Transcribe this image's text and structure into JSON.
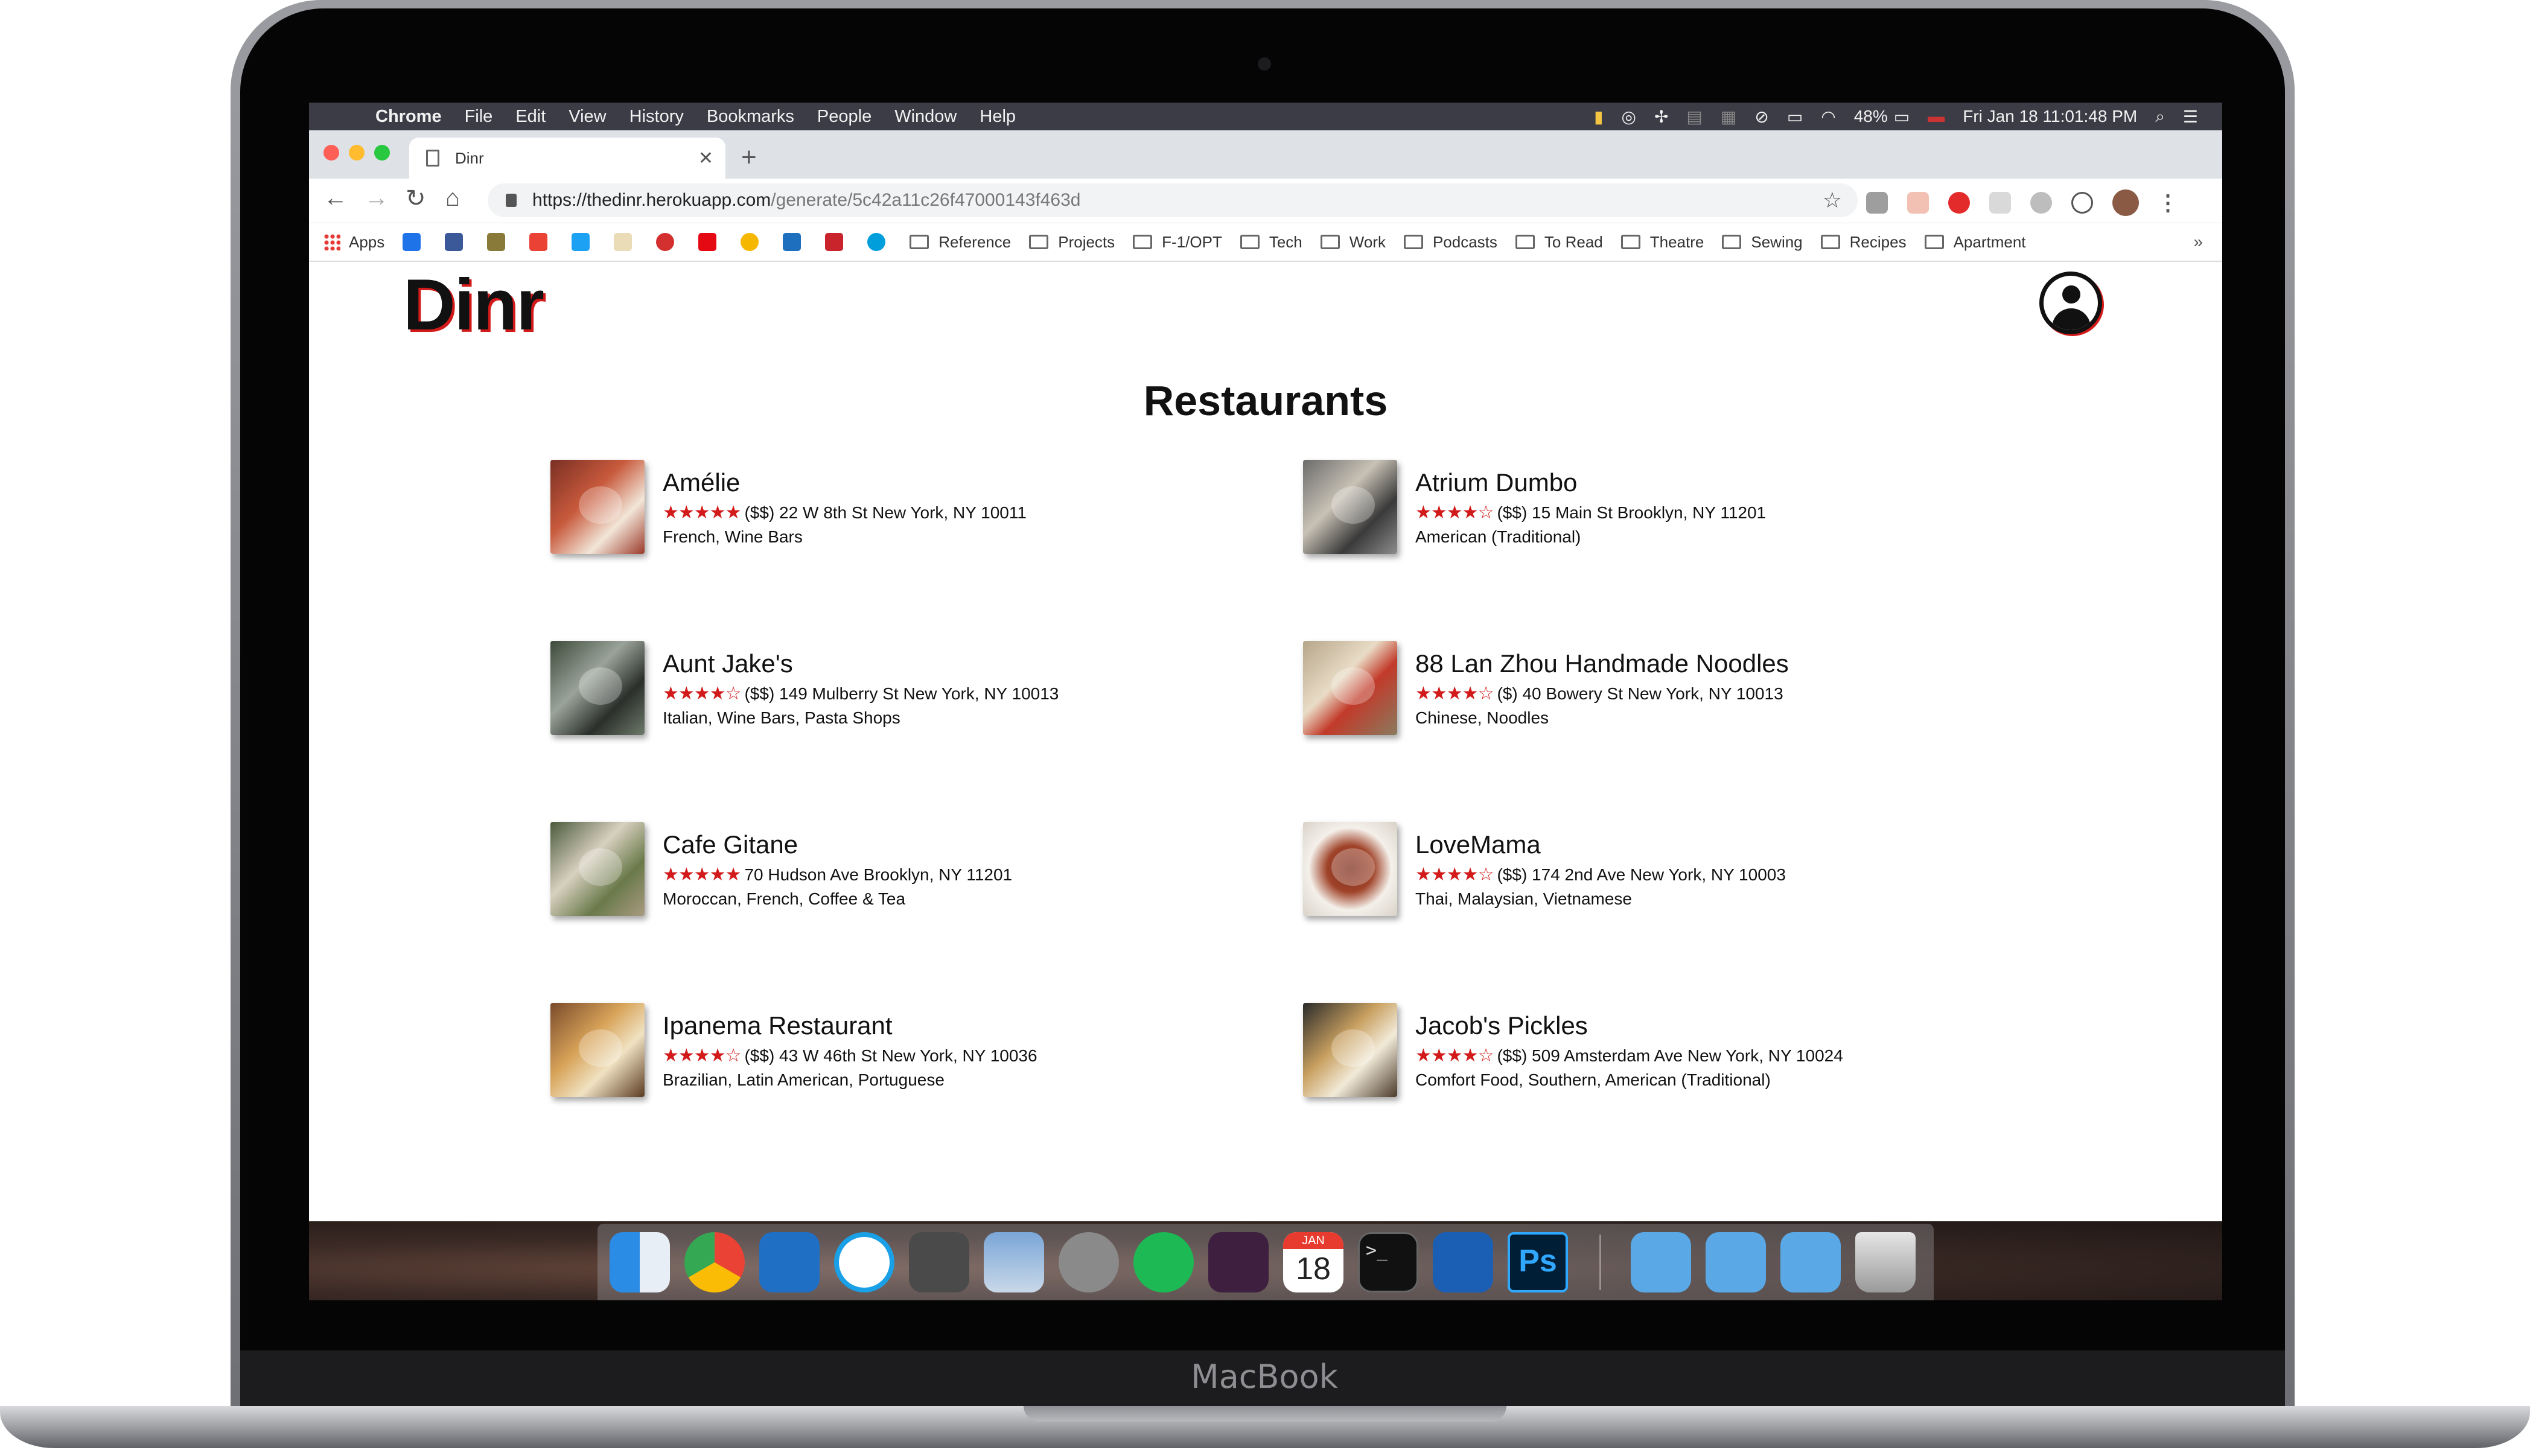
{
  "device": {
    "brand_label": "MacBook"
  },
  "menubar": {
    "items": [
      "Chrome",
      "File",
      "Edit",
      "View",
      "History",
      "Bookmarks",
      "People",
      "Window",
      "Help"
    ],
    "battery": "48%",
    "clock": "Fri Jan 18  11:01:48 PM"
  },
  "browser": {
    "tab_title": "Dinr",
    "url_host": "https://thedinr.herokuapp.com",
    "url_path": "/generate/5c42a11c26f47000143f463d",
    "bookmarks": {
      "apps_label": "Apps",
      "folders": [
        "Reference",
        "Projects",
        "F-1/OPT",
        "Tech",
        "Work",
        "Podcasts",
        "To Read",
        "Theatre",
        "Sewing",
        "Recipes",
        "Apartment"
      ]
    }
  },
  "page": {
    "logo": "Dinr",
    "heading": "Restaurants",
    "restaurants": [
      {
        "name": "Amélie",
        "stars": "★★★★★",
        "detail": "($$) 22 W 8th St New York, NY 10011",
        "categories": "French, Wine Bars"
      },
      {
        "name": "Atrium Dumbo",
        "stars": "★★★★☆",
        "detail": "($$) 15 Main St Brooklyn, NY 11201",
        "categories": "American (Traditional)"
      },
      {
        "name": "Aunt Jake's",
        "stars": "★★★★☆",
        "detail": "($$) 149 Mulberry St New York, NY 10013",
        "categories": "Italian, Wine Bars, Pasta Shops"
      },
      {
        "name": "88 Lan Zhou Handmade Noodles",
        "stars": "★★★★☆",
        "detail": "($) 40 Bowery St New York, NY 10013",
        "categories": "Chinese, Noodles"
      },
      {
        "name": "Cafe Gitane",
        "stars": "★★★★★",
        "detail": "70 Hudson Ave Brooklyn, NY 11201",
        "categories": "Moroccan, French, Coffee & Tea"
      },
      {
        "name": "LoveMama",
        "stars": "★★★★☆",
        "detail": "($$) 174 2nd Ave New York, NY 10003",
        "categories": "Thai, Malaysian, Vietnamese"
      },
      {
        "name": "Ipanema Restaurant",
        "stars": "★★★★☆",
        "detail": "($$) 43 W 46th St New York, NY 10036",
        "categories": "Brazilian, Latin American, Portuguese"
      },
      {
        "name": "Jacob's Pickles",
        "stars": "★★★★☆",
        "detail": "($$) 509 Amsterdam Ave New York, NY 10024",
        "categories": "Comfort Food, Southern, American (Traditional)"
      }
    ]
  },
  "dock": {
    "calendar_month": "JAN",
    "calendar_day": "18",
    "ps_label": "Ps"
  }
}
